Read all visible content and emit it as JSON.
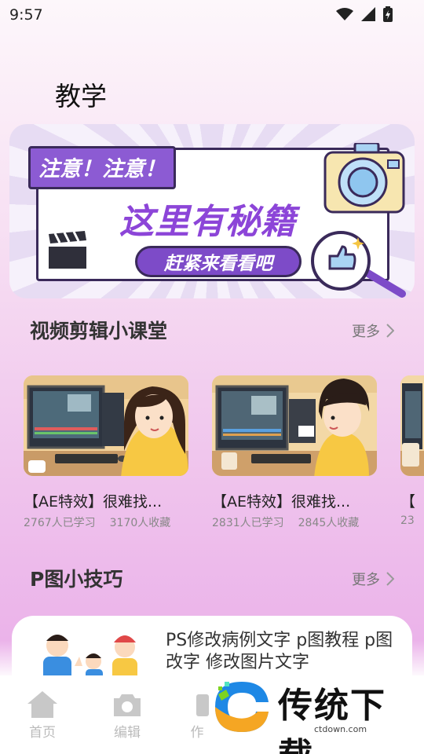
{
  "status_bar": {
    "time": "9:57"
  },
  "page": {
    "title": "教学"
  },
  "banner": {
    "tag": "注意！注意！",
    "headline": "这里有秘籍",
    "button": "赶紧来看看吧",
    "page_count": 3,
    "active_index": 1
  },
  "video_section": {
    "title": "视频剪辑小课堂",
    "more": "更多",
    "items": [
      {
        "title": "【AE特效】很难找...",
        "learners": "2767人已学习",
        "favorites": "3170人收藏"
      },
      {
        "title": "【AE特效】很难找...",
        "learners": "2831人已学习",
        "favorites": "2845人收藏"
      },
      {
        "title": "【",
        "learners": "23",
        "favorites": ""
      }
    ]
  },
  "tips_section": {
    "title": "P图小技巧",
    "more": "更多",
    "first_item": {
      "title": "PS修改病例文字 p图教程 p图改字 修改图片文字"
    }
  },
  "tab_bar": {
    "tabs": [
      {
        "label": "首页",
        "icon": "home-icon"
      },
      {
        "label": "编辑",
        "icon": "camera-icon"
      },
      {
        "label": "作",
        "icon": "works-icon"
      }
    ]
  },
  "watermark": {
    "brand": "传统下载",
    "site": "ctdown.com"
  },
  "colors": {
    "accent": "#8c45d8",
    "tag": "#8c5bd3"
  }
}
